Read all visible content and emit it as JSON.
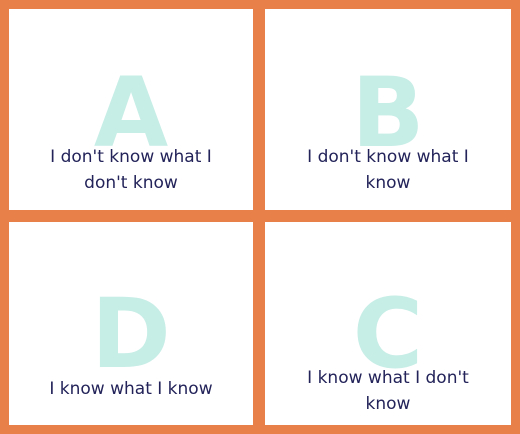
{
  "colors": {
    "border": "#e8804a",
    "panel": "#ffffff",
    "letter": "#c6ede6",
    "text": "#23235a"
  },
  "quadrants": {
    "a": {
      "letter": "A",
      "lines": [
        "I don't know what I",
        "don't know"
      ]
    },
    "b": {
      "letter": "B",
      "lines": [
        "I don't know what I",
        "know"
      ]
    },
    "d": {
      "letter": "D",
      "lines": [
        "I know what I know"
      ]
    },
    "c": {
      "letter": "C",
      "lines": [
        "I know what I don't",
        "know"
      ]
    }
  }
}
